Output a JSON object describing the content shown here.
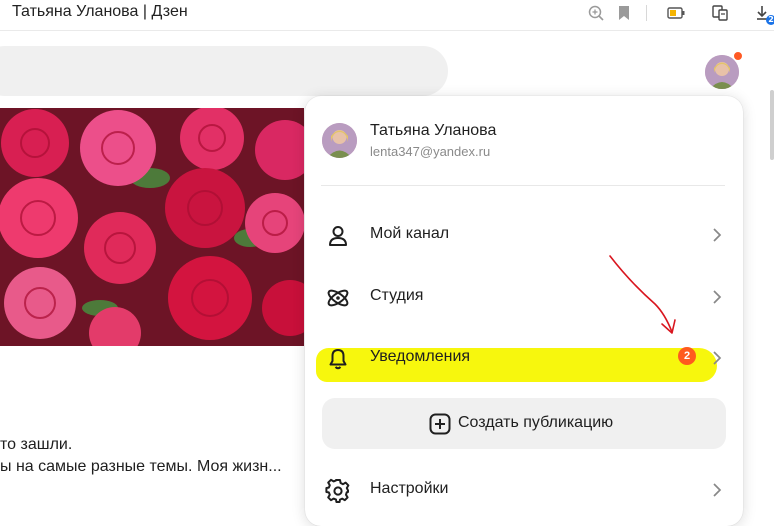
{
  "browser": {
    "tab_title": "Татьяна Уланова | Дзен",
    "download_count": "2"
  },
  "page": {
    "description_lines": [
      "то зашли.",
      "ы на самые разные темы. Моя жизн..."
    ]
  },
  "menu": {
    "user_name": "Татьяна Уланова",
    "user_email": "lenta347@yandex.ru",
    "items": [
      {
        "label": "Мой канал",
        "icon": "person-icon"
      },
      {
        "label": "Студия",
        "icon": "atom-icon"
      },
      {
        "label": "Уведомления",
        "icon": "bell-icon",
        "badge": "2"
      }
    ],
    "create_button_label": "Создать публикацию",
    "settings_label": "Настройки"
  },
  "colors": {
    "highlight": "#f7f700",
    "badge": "#ff5a1e",
    "annotation_arrow": "#d9161f"
  }
}
